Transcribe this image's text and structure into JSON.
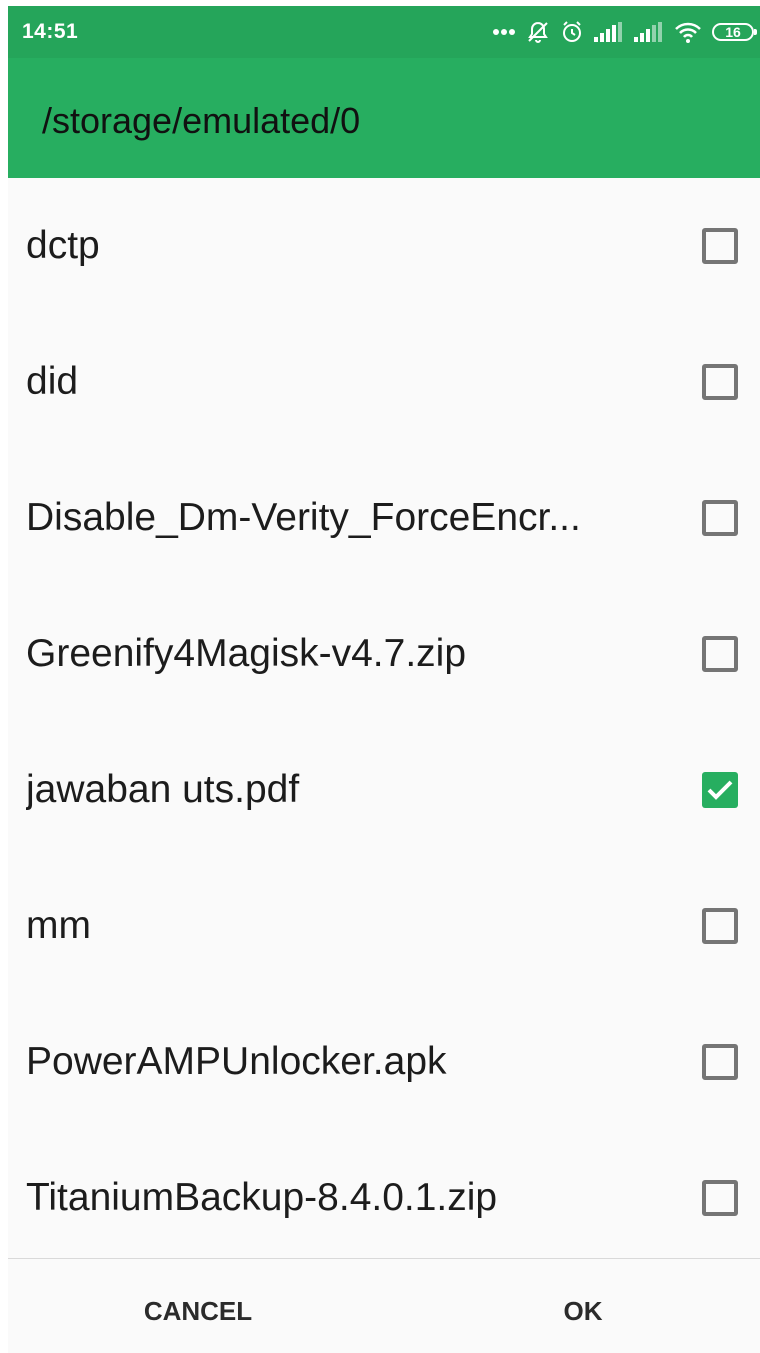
{
  "status_bar": {
    "time": "14:51",
    "icons": [
      "more-dots-icon",
      "notifications-off-icon",
      "alarm-icon",
      "signal-1-icon",
      "signal-2-icon",
      "wifi-icon",
      "battery-icon"
    ],
    "battery_level": "16"
  },
  "header": {
    "path": "/storage/emulated/0"
  },
  "files": [
    {
      "name": "dctp",
      "checked": false
    },
    {
      "name": "did",
      "checked": false
    },
    {
      "name": "Disable_Dm-Verity_ForceEncr...",
      "checked": false
    },
    {
      "name": "Greenify4Magisk-v4.7.zip",
      "checked": false
    },
    {
      "name": "jawaban uts.pdf",
      "checked": true
    },
    {
      "name": "mm",
      "checked": false
    },
    {
      "name": "PowerAMPUnlocker.apk",
      "checked": false
    },
    {
      "name": "TitaniumBackup-8.4.0.1.zip",
      "checked": false
    }
  ],
  "footer": {
    "cancel_label": "CANCEL",
    "ok_label": "OK"
  },
  "colors": {
    "accent": "#27ae60",
    "status_bar": "#25a55a",
    "checkbox_border": "#757575",
    "background": "#fafafa"
  }
}
